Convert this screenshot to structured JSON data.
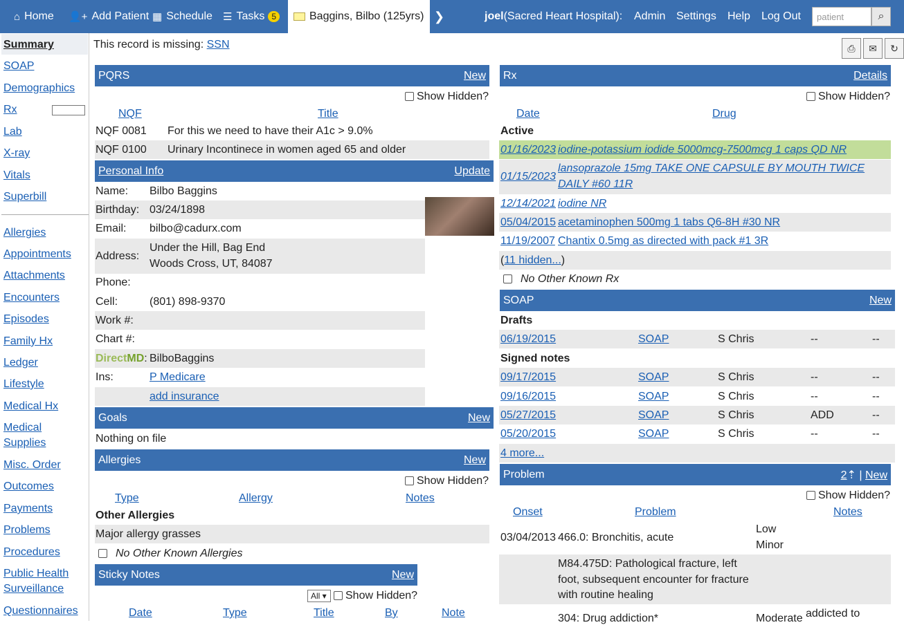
{
  "nav": {
    "home": "Home",
    "add_patient": "Add Patient",
    "schedule": "Schedule",
    "tasks": "Tasks",
    "tasks_count": "5",
    "patient_tab": "Baggins, Bilbo (125yrs)",
    "user": "joel",
    "facility": "(Sacred Heart Hospital):",
    "admin": "Admin",
    "settings": "Settings",
    "help": "Help",
    "logout": "Log Out",
    "search_placeholder": "patient"
  },
  "sidebar": [
    "Summary",
    "SOAP",
    "Demographics",
    "Rx",
    "Lab",
    "X-ray",
    "Vitals",
    "Superbill",
    "Allergies",
    "Appointments",
    "Attachments",
    "Encounters",
    "Episodes",
    "Family Hx",
    "Ledger",
    "Lifestyle",
    "Medical Hx",
    "Medical Supplies",
    "Misc. Order",
    "Outcomes",
    "Payments",
    "Problems",
    "Procedures",
    "Public Health Surveillance",
    "Questionnaires"
  ],
  "missing": {
    "label": "This record is missing:",
    "item": "SSN"
  },
  "pqrs": {
    "title": "PQRS",
    "new": "New",
    "show_hidden": "Show Hidden?",
    "col_nqf": "NQF",
    "col_title": "Title",
    "rows": [
      [
        "NQF 0081",
        "For this we need to have their A1c > 9.0%"
      ],
      [
        "NQF 0100",
        "Urinary Incontinece in women aged 65 and older"
      ]
    ]
  },
  "personal": {
    "title": "Personal Info",
    "update": "Update",
    "name_l": "Name:",
    "name": "Bilbo Baggins",
    "birth_l": "Birthday:",
    "birth": "03/24/1898",
    "email_l": "Email:",
    "email": "bilbo@cadurx.com",
    "addr_l": "Address:",
    "addr1": "Under the Hill, Bag End",
    "addr2": "Woods Cross, UT, 84087",
    "phone_l": "Phone:",
    "cell_l": "Cell:",
    "cell": "(801) 898-9370",
    "work_l": "Work #:",
    "chart_l": "Chart #:",
    "direct_a": "Direct",
    "direct_b": "MD",
    "direct_c": ":",
    "direct": "BilboBaggins",
    "ins_l": "Ins:",
    "ins": "P Medicare",
    "add_ins": "add insurance"
  },
  "goals": {
    "title": "Goals",
    "new": "New",
    "empty": "Nothing on file"
  },
  "allergies": {
    "title": "Allergies",
    "new": "New",
    "show_hidden": "Show Hidden?",
    "col_type": "Type",
    "col_allergy": "Allergy",
    "col_notes": "Notes",
    "other": "Other Allergies",
    "item": "Major allergy grasses",
    "none": "No Other Known Allergies"
  },
  "sticky": {
    "title": "Sticky Notes",
    "new": "New",
    "filter": "All",
    "show_hidden": "Show Hidden?",
    "cols": [
      "Date",
      "Type",
      "Title",
      "By",
      "Note"
    ]
  },
  "rx": {
    "title": "Rx",
    "details": "Details",
    "show_hidden": "Show Hidden?",
    "col_date": "Date",
    "col_drug": "Drug",
    "active": "Active",
    "rows": [
      {
        "date": "01/16/2023",
        "drug": "iodine-potassium iodide 5000mcg-7500mcg 1 caps QD NR"
      },
      {
        "date": "01/15/2023",
        "drug1": "lansoprazole 15mg TAKE ONE CAPSULE BY MOUTH TWICE",
        "drug2": "DAILY #60 11R"
      },
      {
        "date": "12/14/2021",
        "drug": "iodine NR"
      },
      {
        "date": "05/04/2015",
        "drug": "acetaminophen 500mg 1 tabs Q6-8H #30 NR"
      },
      {
        "date": "11/19/2007",
        "drug": "Chantix 0.5mg as directed with pack #1 3R"
      }
    ],
    "hidden_pre": "(",
    "hidden": "11 hidden...",
    "hidden_post": ")",
    "none": "No Other Known Rx"
  },
  "soap": {
    "title": "SOAP",
    "new": "New",
    "drafts": "Drafts",
    "signed": "Signed notes",
    "more": "4 more...",
    "rows": [
      [
        "06/19/2015",
        "SOAP",
        "S Chris",
        "--",
        "--"
      ],
      [
        "09/17/2015",
        "SOAP",
        "S Chris",
        "--",
        "--"
      ],
      [
        "09/16/2015",
        "SOAP",
        "S Chris",
        "--",
        "--"
      ],
      [
        "05/27/2015",
        "SOAP",
        "S Chris",
        "ADD",
        "--"
      ],
      [
        "05/20/2015",
        "SOAP",
        "S Chris",
        "--",
        "--"
      ]
    ]
  },
  "problem": {
    "title": "Problem",
    "count": "2",
    "sep": "|",
    "new": "New",
    "show_hidden": "Show Hidden?",
    "col_onset": "Onset",
    "col_problem": "Problem",
    "col_notes": "Notes",
    "r1_onset": "03/04/2013",
    "r1_problem": "466.0: Bronchitis, acute",
    "r1_sev1": "Low",
    "r1_sev2": "Minor",
    "r2_p1": "M84.475D: Pathological fracture, left",
    "r2_p2": "foot, subsequent encounter for fracture",
    "r2_p3": "with routine healing",
    "r3_problem": "304: Drug addiction*",
    "r3_sev": "Moderate",
    "r3_notes": "addicted to"
  }
}
